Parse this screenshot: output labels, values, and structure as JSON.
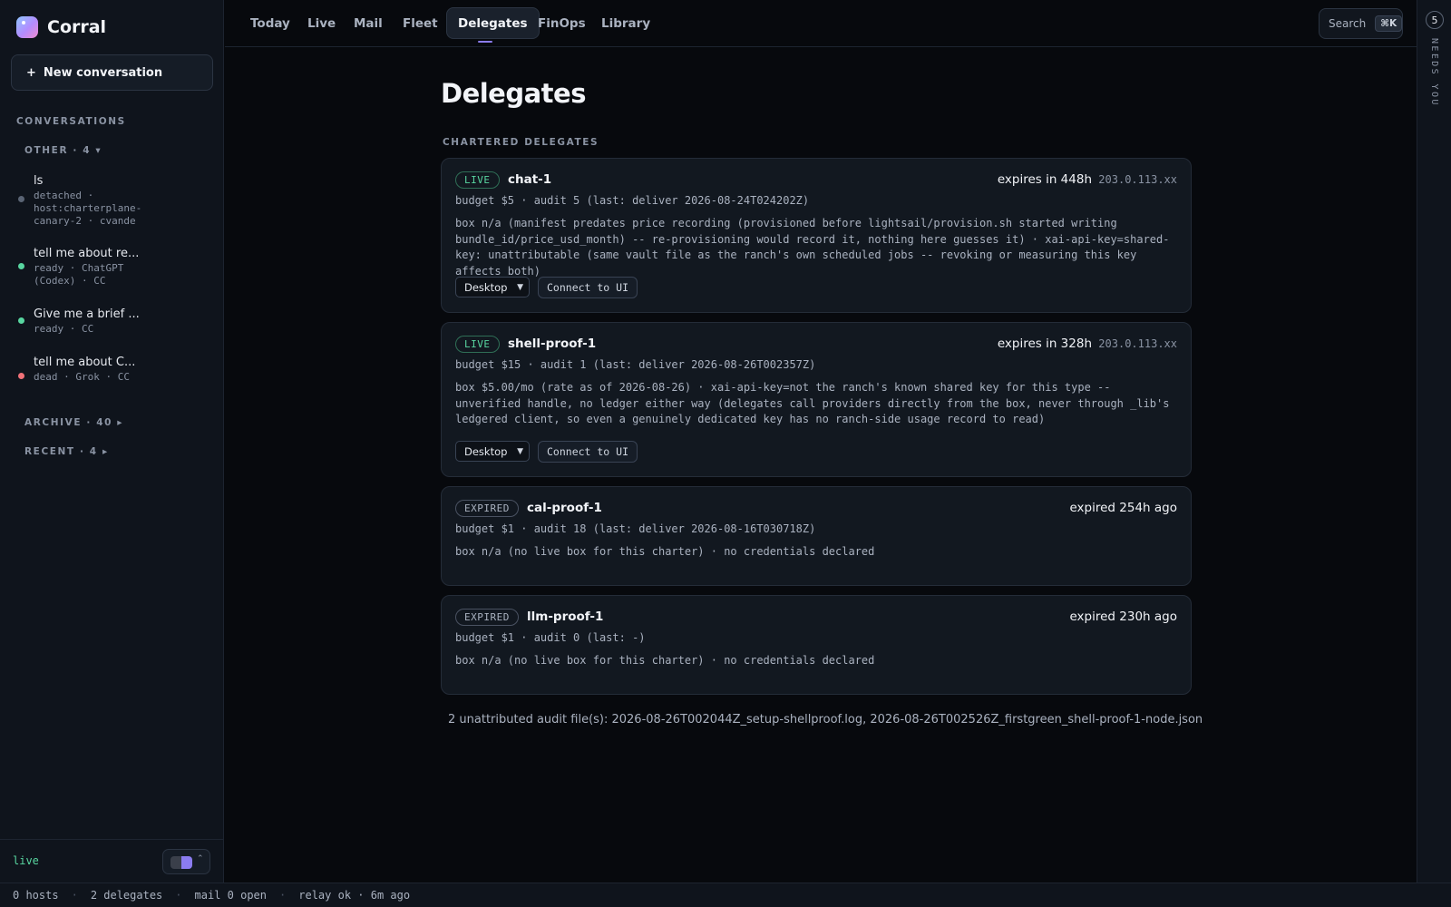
{
  "app": {
    "name": "Corral"
  },
  "sidebar": {
    "new_conversation": "New conversation",
    "conversations_label": "CONVERSATIONS",
    "other_label": "OTHER · 4 ▾",
    "items": [
      {
        "title": "ls",
        "sub": "detached · host:charterplane-canary-2 · cvande",
        "status": "detached"
      },
      {
        "title": "tell me about re...",
        "sub": "ready · ChatGPT (Codex) · CC",
        "status": "ready"
      },
      {
        "title": "Give me a brief ...",
        "sub": "ready · CC",
        "status": "ready"
      },
      {
        "title": "tell me about C...",
        "sub": "dead · Grok · CC",
        "status": "dead"
      }
    ],
    "archive_label": "ARCHIVE · 40 ▸",
    "recent_label": "RECENT · 4 ▸",
    "footer_status": "live"
  },
  "nav": {
    "tabs": [
      "Today",
      "Live",
      "Mail",
      "Fleet",
      "Delegates",
      "FinOps",
      "Library"
    ],
    "active": "Delegates",
    "search_label": "Search",
    "search_shortcut": "⌘K"
  },
  "rail": {
    "count": "5",
    "label": "NEEDS YOU"
  },
  "main": {
    "title": "Delegates",
    "subheading": "CHARTERED DELEGATES",
    "cards": [
      {
        "status": "LIVE",
        "name": "chat-1",
        "expiry": "expires in 448h",
        "ip": "203.0.113.xx",
        "budget": "budget $5 · audit 5 (last: deliver 2026-08-24T024202Z)",
        "description": "box n/a (manifest predates price recording (provisioned before lightsail/provision.sh started writing bundle_id/price_usd_month) -- re-provisioning would record it, nothing here guesses it) · xai-api-key=shared-key: unattributable (same vault file as the ranch's own scheduled jobs -- revoking or measuring this key affects both)",
        "select_value": "Desktop",
        "connect_label": "Connect to UI"
      },
      {
        "status": "LIVE",
        "name": "shell-proof-1",
        "expiry": "expires in 328h",
        "ip": "203.0.113.xx",
        "budget": "budget $15 · audit 1 (last: deliver 2026-08-26T002357Z)",
        "description": "box $5.00/mo (rate as of 2026-08-26) · xai-api-key=not the ranch's known shared key for this type -- unverified handle, no ledger either way (delegates call providers directly from the box, never through _lib's ledgered client, so even a genuinely dedicated key has no ranch-side usage record to read)",
        "select_value": "Desktop",
        "connect_label": "Connect to UI"
      },
      {
        "status": "EXPIRED",
        "name": "cal-proof-1",
        "expiry": "expired 254h ago",
        "budget": "budget $1 · audit 18 (last: deliver 2026-08-16T030718Z)",
        "description": "box n/a (no live box for this charter) · no credentials declared"
      },
      {
        "status": "EXPIRED",
        "name": "llm-proof-1",
        "expiry": "expired 230h ago",
        "budget": "budget $1 · audit 0 (last: -)",
        "description": "box n/a (no live box for this charter) · no credentials declared"
      }
    ],
    "footnote": "2 unattributed audit file(s): 2026-08-26T002044Z_setup-shellproof.log, 2026-08-26T002526Z_firstgreen_shell-proof-1-node.json"
  },
  "statusbar": {
    "items": [
      "0 hosts",
      "2 delegates",
      "mail 0 open",
      "relay ok · 6m ago"
    ]
  },
  "colors": {
    "accent": "#8b7cf0",
    "live": "#58d6a0",
    "dead": "#f07178",
    "detached": "#5a6474"
  }
}
